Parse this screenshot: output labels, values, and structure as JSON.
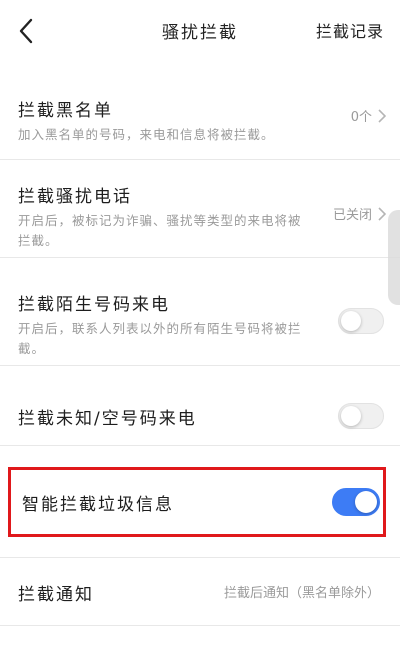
{
  "header": {
    "title": "骚扰拦截",
    "record_label": "拦截记录"
  },
  "rows": [
    {
      "title": "拦截黑名单",
      "desc": "加入黑名单的号码，来电和信息将被拦截。",
      "value": "0个"
    },
    {
      "title": "拦截骚扰电话",
      "desc": "开启后，被标记为诈骗、骚扰等类型的来电将被拦截。",
      "value": "已关闭"
    },
    {
      "title": "拦截陌生号码来电",
      "desc": "开启后，联系人列表以外的所有陌生号码将被拦截。",
      "toggle_on": false
    },
    {
      "title": "拦截未知/空号码来电",
      "toggle_on": false
    },
    {
      "title": "智能拦截垃圾信息",
      "toggle_on": true
    },
    {
      "title": "拦截通知",
      "value": "拦截后通知（黑名单除外）"
    }
  ],
  "colors": {
    "accent": "#3d7cf5",
    "highlight": "#e0181b"
  }
}
